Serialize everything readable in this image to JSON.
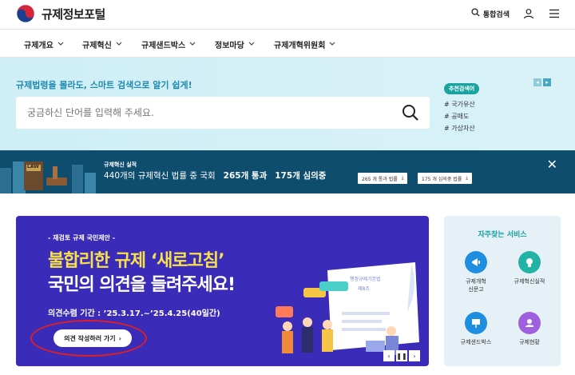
{
  "header": {
    "logo_text": "규제정보포털",
    "search_all_label": "통합검색"
  },
  "nav": {
    "items": [
      {
        "label": "규제개요"
      },
      {
        "label": "규제혁신"
      },
      {
        "label": "규제샌드박스"
      },
      {
        "label": "정보마당"
      },
      {
        "label": "규제개혁위원회"
      }
    ]
  },
  "hero": {
    "title": "규제법령을 몰라도, 스마트 검색으로 알기 쉽게!",
    "search_placeholder": "궁금하신 단어를 입력해 주세요.",
    "recommend_label": "추천검색어",
    "tags": [
      "# 국가유산",
      "# 공매도",
      "# 가상자산"
    ]
  },
  "banner": {
    "logo_text": "LAW",
    "title": "규제혁신 실적",
    "text_prefix": "440개의 규제혁신 법률 중 국회",
    "passed": "265개 통과",
    "reviewing": "175개 심의중",
    "btn_passed": "265 개 통과 법률",
    "btn_reviewing": "175 개 심의중 법률",
    "close": "✕"
  },
  "promo": {
    "subtitle": "- 재검토 규제 국민제안 -",
    "title_line1": "불합리한 규제 ‘새로고침’",
    "title_line2": "국민의 의견을 들려주세요!",
    "period": "의견수렴 기간 : ’25.3.17.~’25.4.25(40일간)",
    "button_label": "의견 작성하러 가기",
    "doc_line1": "행정규제기본법",
    "doc_line2": "제8조"
  },
  "services": {
    "title": "자주찾는 서비스",
    "items": [
      {
        "label": "규제개혁\n신문고",
        "color": "#1e8fe0"
      },
      {
        "label": "규제혁신실적",
        "color": "#22b3a6"
      },
      {
        "label": "규제샌드박스",
        "color": "#1e8fe0"
      },
      {
        "label": "규제현황",
        "color": "#a05ee0"
      }
    ]
  }
}
